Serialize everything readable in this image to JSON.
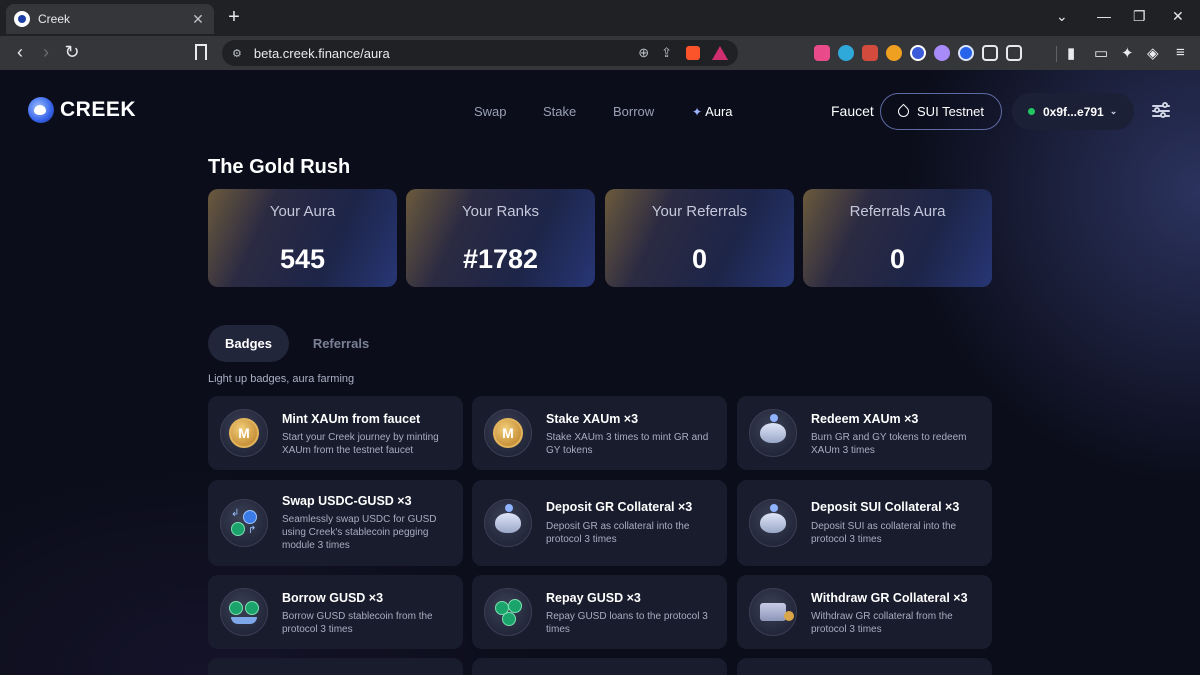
{
  "browser": {
    "tab_title": "Creek",
    "tab_close": "✕",
    "new_tab": "+",
    "url": "beta.creek.finance/aura"
  },
  "app": {
    "logo_text": "CREEK",
    "nav": {
      "swap": "Swap",
      "stake": "Stake",
      "borrow": "Borrow",
      "aura": "Aura"
    },
    "faucet": "Faucet",
    "network": "SUI Testnet",
    "wallet_address": "0x9f...e791"
  },
  "page": {
    "title": "The Gold Rush",
    "stats": [
      {
        "label": "Your Aura",
        "value": "545"
      },
      {
        "label": "Your Ranks",
        "value": "#1782"
      },
      {
        "label": "Your Referrals",
        "value": "0"
      },
      {
        "label": "Referrals Aura",
        "value": "0"
      }
    ],
    "tabs": {
      "badges": "Badges",
      "referrals": "Referrals"
    },
    "hint": "Light up badges, aura farming",
    "badges": [
      {
        "title": "Mint XAUm from faucet",
        "desc": "Start your Creek journey by minting XAUm from the testnet faucet",
        "icon": "gold-coin-icon"
      },
      {
        "title": "Stake XAUm ×3",
        "desc": "Stake XAUm 3 times to mint GR and GY tokens",
        "icon": "gold-coin-icon"
      },
      {
        "title": "Redeem XAUm ×3",
        "desc": "Burn GR and GY tokens to redeem XAUm 3 times",
        "icon": "piggy-bank-icon"
      },
      {
        "title": "Swap USDC-GUSD ×3",
        "desc": "Seamlessly swap USDC for GUSD using Creek's stablecoin pegging module 3 times",
        "icon": "swap-coins-icon"
      },
      {
        "title": "Deposit GR Collateral ×3",
        "desc": "Deposit GR as collateral into the protocol 3 times",
        "icon": "piggy-bank-icon"
      },
      {
        "title": "Deposit SUI Collateral ×3",
        "desc": "Deposit SUI as collateral into the protocol 3 times",
        "icon": "piggy-bank-icon"
      },
      {
        "title": "Borrow GUSD ×3",
        "desc": "Borrow GUSD stablecoin from the protocol 3 times",
        "icon": "hand-coins-icon"
      },
      {
        "title": "Repay GUSD ×3",
        "desc": "Repay GUSD loans to the protocol 3 times",
        "icon": "coin-stack-icon"
      },
      {
        "title": "Withdraw GR Collateral ×3",
        "desc": "Withdraw GR collateral from the protocol 3 times",
        "icon": "wallet-icon"
      }
    ]
  },
  "colors": {
    "accent_green": "#22c55e",
    "gold": "#c8933b",
    "card_bg": "#191c2c"
  }
}
